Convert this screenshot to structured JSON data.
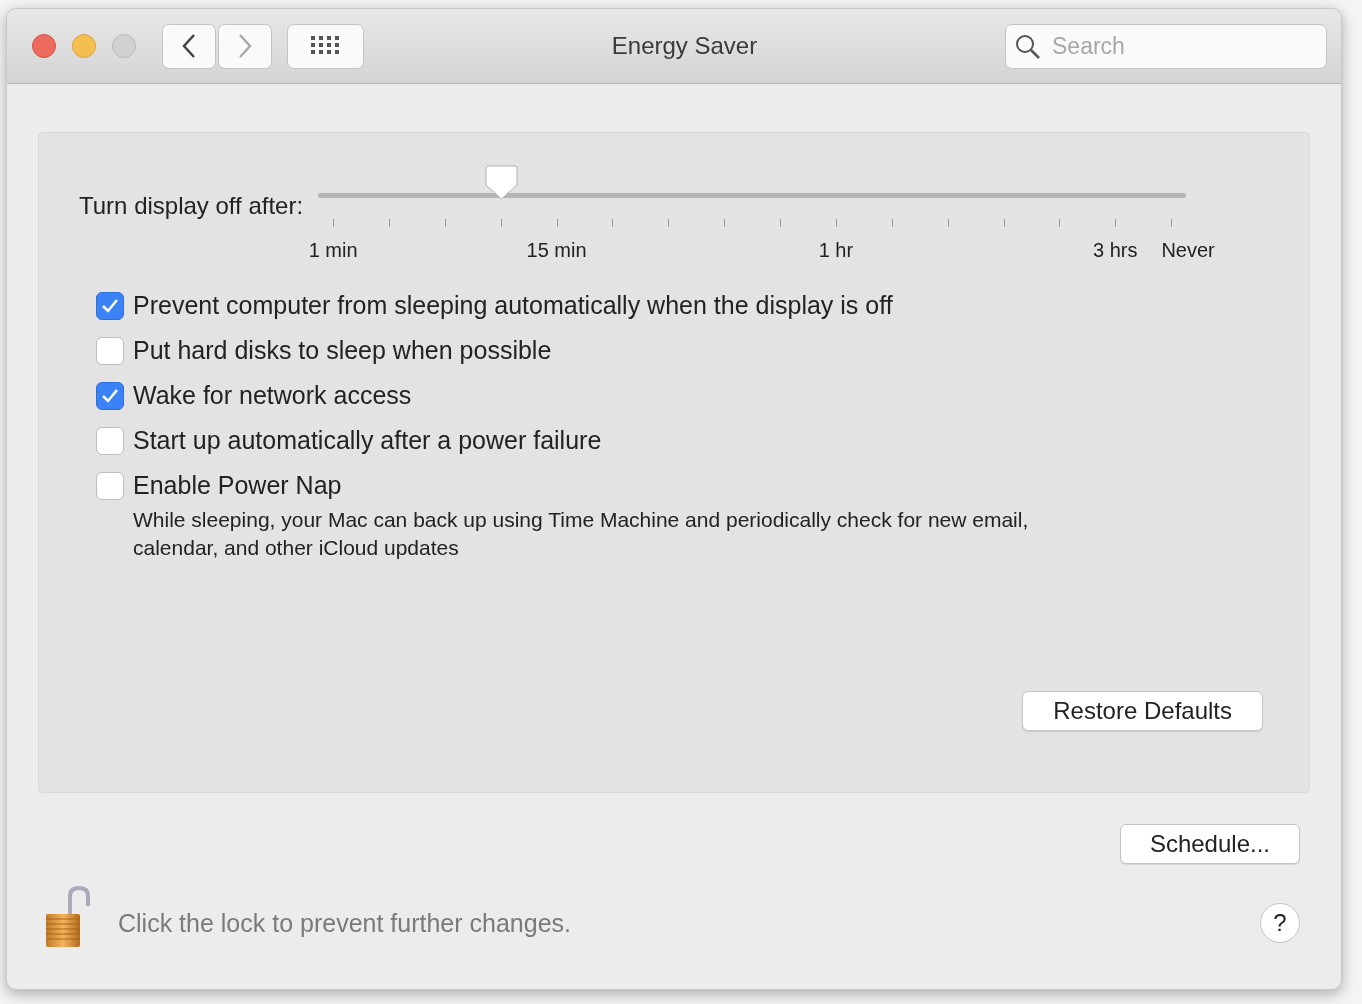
{
  "window": {
    "title": "Energy Saver",
    "search": {
      "placeholder": "Search"
    }
  },
  "display_sleep": {
    "label": "Turn display off after:",
    "level": 0.2,
    "tick_labels": [
      "1 min",
      "15 min",
      "1 hr",
      "3 hrs",
      "Never"
    ]
  },
  "options": [
    {
      "label": "Prevent computer from sleeping automatically when the display is off",
      "checked": true
    },
    {
      "label": "Put hard disks to sleep when possible",
      "checked": false
    },
    {
      "label": "Wake for network access",
      "checked": true
    },
    {
      "label": "Start up automatically after a power failure",
      "checked": false
    },
    {
      "label": "Enable Power Nap",
      "checked": false,
      "description": "While sleeping, your Mac can back up using Time Machine and periodically check for new email, calendar, and other iCloud updates"
    }
  ],
  "buttons": {
    "restore": "Restore Defaults",
    "schedule": "Schedule..."
  },
  "lock_message": "Click the lock to prevent further changes.",
  "help": "?"
}
